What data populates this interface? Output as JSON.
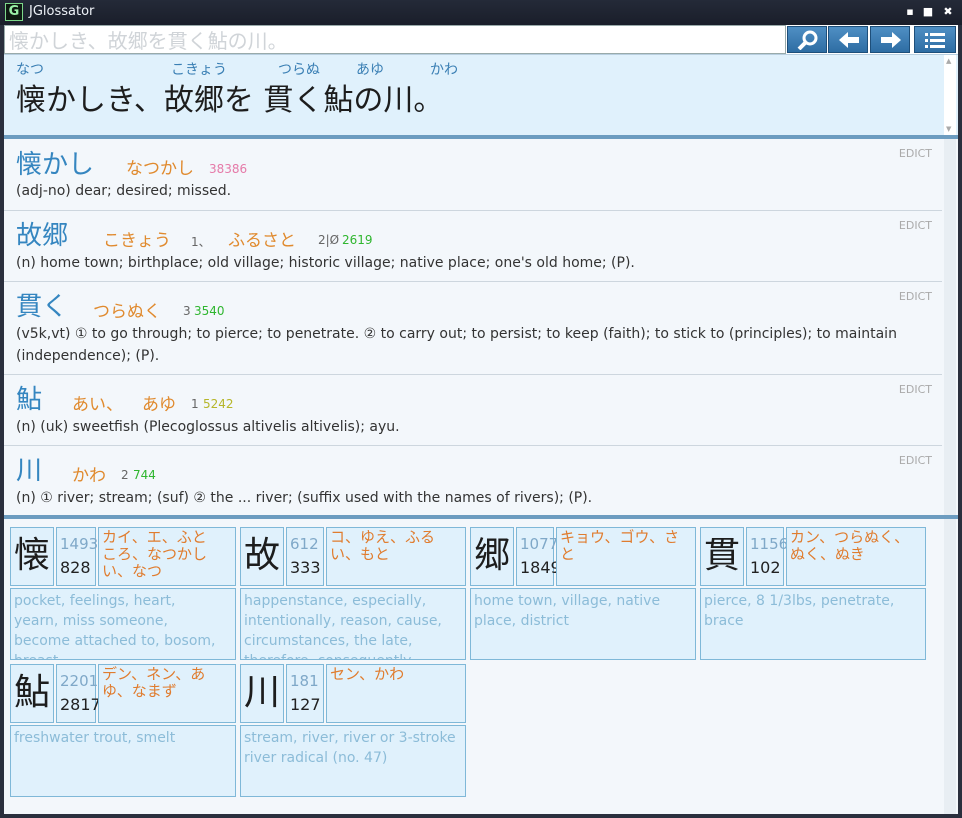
{
  "window": {
    "app_icon": "G",
    "title": "JGlossator",
    "minimize": "▪",
    "maximize": "■",
    "close": "✖"
  },
  "toolbar": {
    "input_value": "懐かしき、故郷を貫く鮎の川。"
  },
  "furigana": {
    "sentence": "懐かしき、故郷を 貫く鮎の川。",
    "segments": [
      {
        "base": "懐かしき、",
        "ruby": "なつ"
      },
      {
        "base": "故郷",
        "ruby": "こきょう"
      },
      {
        "base": "を ",
        "ruby": ""
      },
      {
        "base": "貫く",
        "ruby": "つらぬ"
      },
      {
        "base": "鮎",
        "ruby": "あゆ"
      },
      {
        "base": "の",
        "ruby": ""
      },
      {
        "base": "川",
        "ruby": "かわ"
      },
      {
        "base": "。",
        "ruby": ""
      }
    ]
  },
  "entries": [
    {
      "keyword": "懐かし",
      "reading": "なつかし",
      "extra": "",
      "freq": "38386",
      "freq_color": "#e57aa8",
      "source": "EDICT",
      "gloss": "(adj-no) dear; desired; missed."
    },
    {
      "keyword": "故郷",
      "reading": "こきょう",
      "sep": "1、",
      "reading2": "ふるさと",
      "extra": "2|Ø",
      "freq": "2619",
      "freq_color": "#2fb62f",
      "source": "EDICT",
      "gloss": "(n) home town; birthplace; old village; historic village; native place; one's old home; (P)."
    },
    {
      "keyword": "貫く",
      "reading": "つらぬく",
      "extra": "3",
      "freq": "3540",
      "freq_color": "#2fb62f",
      "source": "EDICT",
      "gloss": "(v5k,vt) ① to go through; to pierce; to penetrate. ② to carry out; to persist; to keep (faith); to stick to (principles); to maintain (independence); (P)."
    },
    {
      "keyword": "鮎",
      "reading": "あい、",
      "reading2": "あゆ",
      "extra": "1",
      "freq": "5242",
      "freq_color": "#b6b62a",
      "source": "EDICT",
      "gloss": "(n) (uk) sweetfish (Plecoglossus altivelis altivelis); ayu."
    },
    {
      "keyword": "川",
      "reading": "かわ",
      "extra": "2",
      "freq": "744",
      "freq_color": "#2fb62f",
      "source": "EDICT",
      "gloss": "(n) ① river; stream; (suf) ② the ... river; (suffix used with the names of rivers); (P)."
    }
  ],
  "kanji": [
    {
      "char": "懐",
      "n1": "1493",
      "n2": "828",
      "readings": "カイ、エ、ふところ、なつかしい、なつ",
      "meaning": "pocket, feelings, heart, yearn, miss someone, become attached to, bosom, breast"
    },
    {
      "char": "故",
      "n1": "612",
      "n2": "333",
      "readings": "コ、ゆえ、ふるい、もと",
      "meaning": "happenstance, especially, intentionally, reason, cause, circumstances, the late, therefore, consequently"
    },
    {
      "char": "郷",
      "n1": "1077",
      "n2": "1849",
      "readings": "キョウ、ゴウ、さと",
      "meaning": "home town, village, native place, district"
    },
    {
      "char": "貫",
      "n1": "1156",
      "n2": "102",
      "readings": "カン、つらぬく、ぬく、ぬき",
      "meaning": "pierce, 8 1/3lbs, penetrate, brace"
    },
    {
      "char": "鮎",
      "n1": "2201",
      "n2": "2817",
      "readings": "デン、ネン、あゆ、なまず",
      "meaning": "freshwater trout, smelt"
    },
    {
      "char": "川",
      "n1": "181",
      "n2": "127",
      "readings": "セン、かわ",
      "meaning": "stream, river, river or 3-stroke river radical (no. 47)"
    }
  ]
}
